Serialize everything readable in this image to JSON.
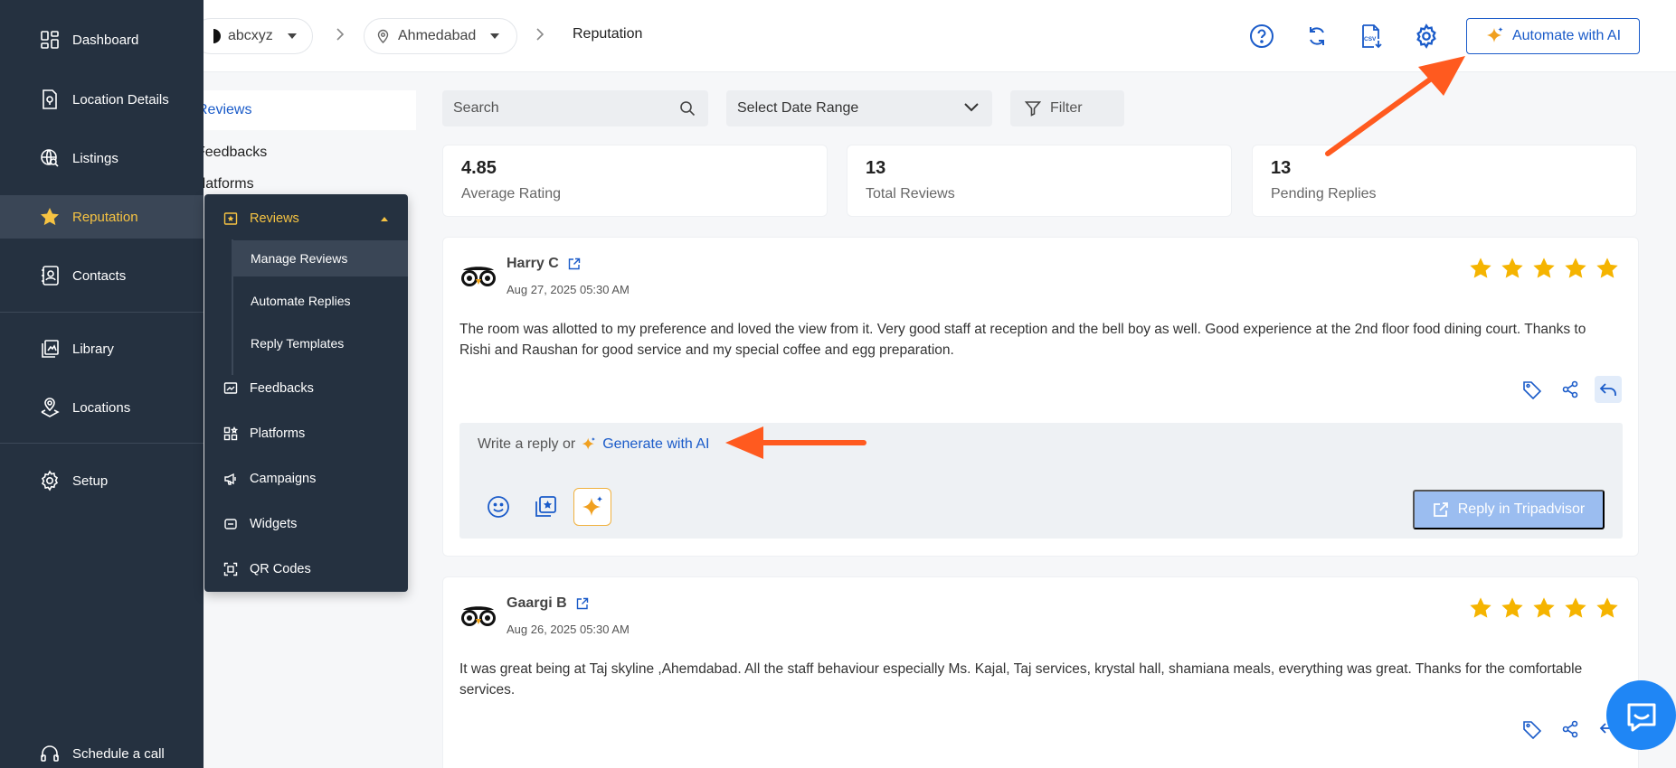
{
  "sidebar": {
    "items": [
      {
        "label": "Dashboard",
        "icon": "dashboard-icon"
      },
      {
        "label": "Location Details",
        "icon": "location-details-icon"
      },
      {
        "label": "Listings",
        "icon": "listings-icon"
      },
      {
        "label": "Reputation",
        "icon": "star-icon",
        "active": true
      },
      {
        "label": "Contacts",
        "icon": "contacts-icon"
      },
      {
        "label": "Library",
        "icon": "library-icon"
      },
      {
        "label": "Locations",
        "icon": "locations-icon"
      },
      {
        "label": "Setup",
        "icon": "gear-icon"
      }
    ],
    "schedule_label": "Schedule a call"
  },
  "flyout": {
    "header": "Reviews",
    "sub_items": [
      "Manage Reviews",
      "Automate Replies",
      "Reply Templates"
    ],
    "items": [
      "Feedbacks",
      "Platforms",
      "Campaigns",
      "Widgets",
      "QR Codes"
    ]
  },
  "subpanel": {
    "items": [
      "Reviews",
      "Feedbacks",
      "Platforms"
    ]
  },
  "topbar": {
    "account": "abcxyz",
    "location": "Ahmedabad",
    "current": "Reputation",
    "automate_label": "Automate with AI"
  },
  "filters": {
    "search_placeholder": "Search",
    "date_range": "Select Date Range",
    "filter_label": "Filter"
  },
  "stats": [
    {
      "value": "4.85",
      "label": "Average Rating"
    },
    {
      "value": "13",
      "label": "Total Reviews"
    },
    {
      "value": "13",
      "label": "Pending Replies"
    }
  ],
  "reviews": [
    {
      "name": "Harry C",
      "date": "Aug 27, 2025 05:30 AM",
      "rating": 5,
      "text": "The room was allotted to my preference and loved the view from it. Very good staff at reception and the bell boy as well. Good experience at the 2nd floor food dining court. Thanks to Rishi and Raushan for good service and my special coffee and egg preparation."
    },
    {
      "name": "Gaargi B",
      "date": "Aug 26, 2025 05:30 AM",
      "rating": 5,
      "text": "It was great being at Taj skyline ,Ahemdabad. All the staff behaviour especially Ms. Kajal, Taj services, krystal hall, shamiana meals, everything was great. Thanks for the comfortable services."
    }
  ],
  "reply": {
    "placeholder": "Write a reply or",
    "generate_label": "Generate with AI",
    "reply_button": "Reply in Tripadvisor"
  },
  "colors": {
    "sidebar_bg": "#253140",
    "accent": "#1a5bc9",
    "active_yellow": "#f6c342",
    "star": "#f5b400",
    "arrow": "#ff5a1f"
  }
}
